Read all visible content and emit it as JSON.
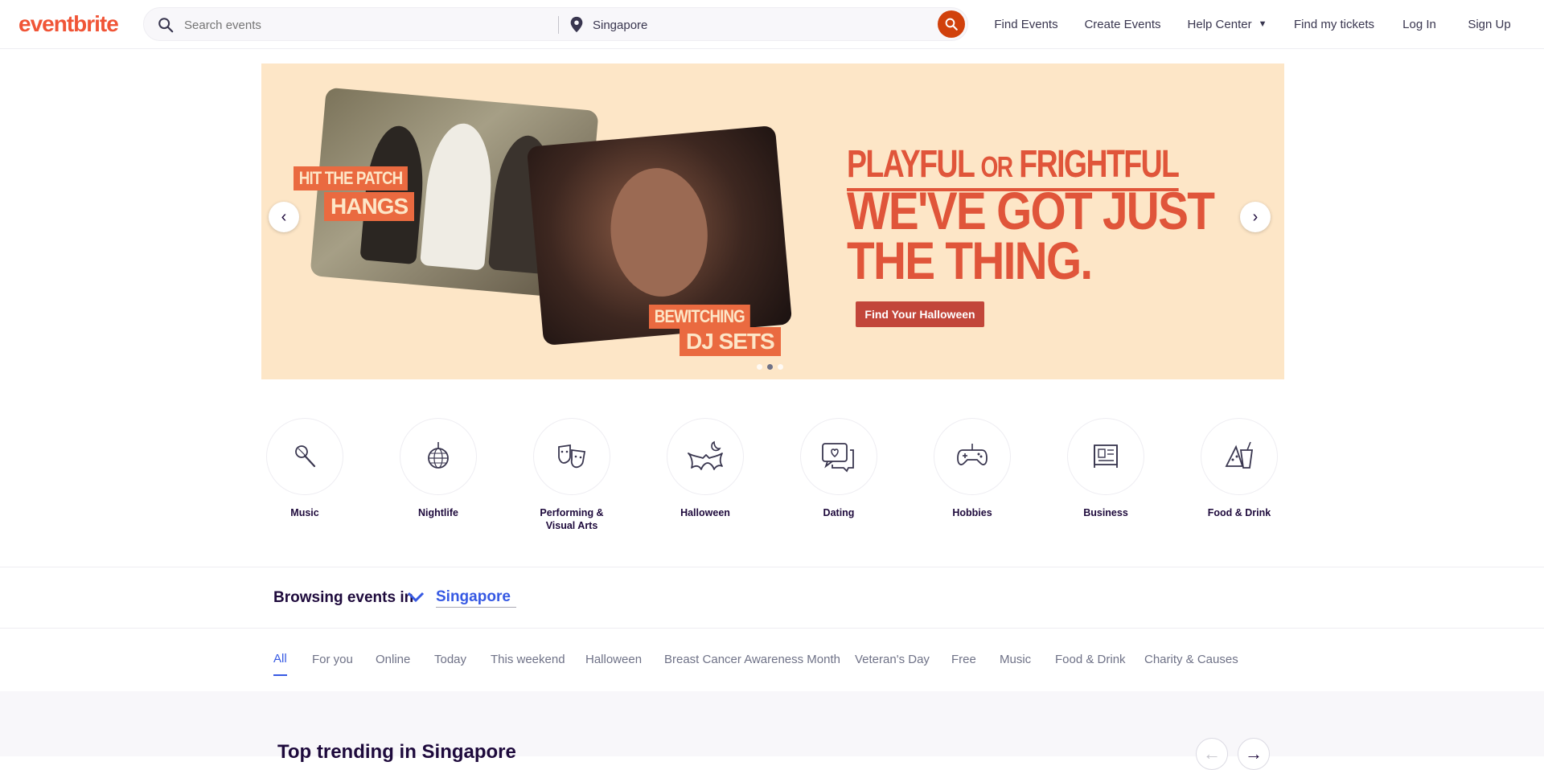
{
  "header": {
    "logo": "eventbrite",
    "search_placeholder": "Search events",
    "location_value": "Singapore",
    "nav": {
      "find_events": "Find Events",
      "create_events": "Create Events",
      "help_center": "Help Center",
      "find_tickets": "Find my tickets",
      "log_in": "Log In",
      "sign_up": "Sign Up"
    }
  },
  "hero": {
    "tag_hit": "HIT THE PATCH",
    "tag_hangs": "HANGS",
    "tag_bewitching": "BEWITCHING",
    "tag_dj": "DJ SETS",
    "headline_a": "PLAYFUL",
    "headline_or": "OR",
    "headline_b": "FRIGHTFUL",
    "headline_line2": "WE'VE GOT JUST",
    "headline_line3": "THE THING.",
    "cta": "Find Your Halloween",
    "prev_glyph": "‹",
    "next_glyph": "›"
  },
  "categories": [
    {
      "label": "Music",
      "icon": "microphone-icon"
    },
    {
      "label": "Nightlife",
      "icon": "disco-ball-icon"
    },
    {
      "label": "Performing & Visual Arts",
      "icon": "theater-masks-icon"
    },
    {
      "label": "Halloween",
      "icon": "bat-moon-icon"
    },
    {
      "label": "Dating",
      "icon": "chat-heart-icon"
    },
    {
      "label": "Hobbies",
      "icon": "gamepad-icon"
    },
    {
      "label": "Business",
      "icon": "presentation-icon"
    },
    {
      "label": "Food & Drink",
      "icon": "food-drink-icon"
    }
  ],
  "browse": {
    "prefix": "Browsing events in",
    "location": "Singapore"
  },
  "tabs": [
    "All",
    "For you",
    "Online",
    "Today",
    "This weekend",
    "Halloween",
    "Breast Cancer Awareness Month",
    "Veteran's Day",
    "Free",
    "Music",
    "Food & Drink",
    "Charity & Causes"
  ],
  "trending": {
    "title": "Top trending in Singapore",
    "prev_glyph": "←",
    "next_glyph": "→"
  },
  "colors": {
    "brand": "#f05537",
    "hero_bg": "#fde6c7",
    "accent_blue": "#3659e3",
    "search_button": "#d1410c"
  }
}
